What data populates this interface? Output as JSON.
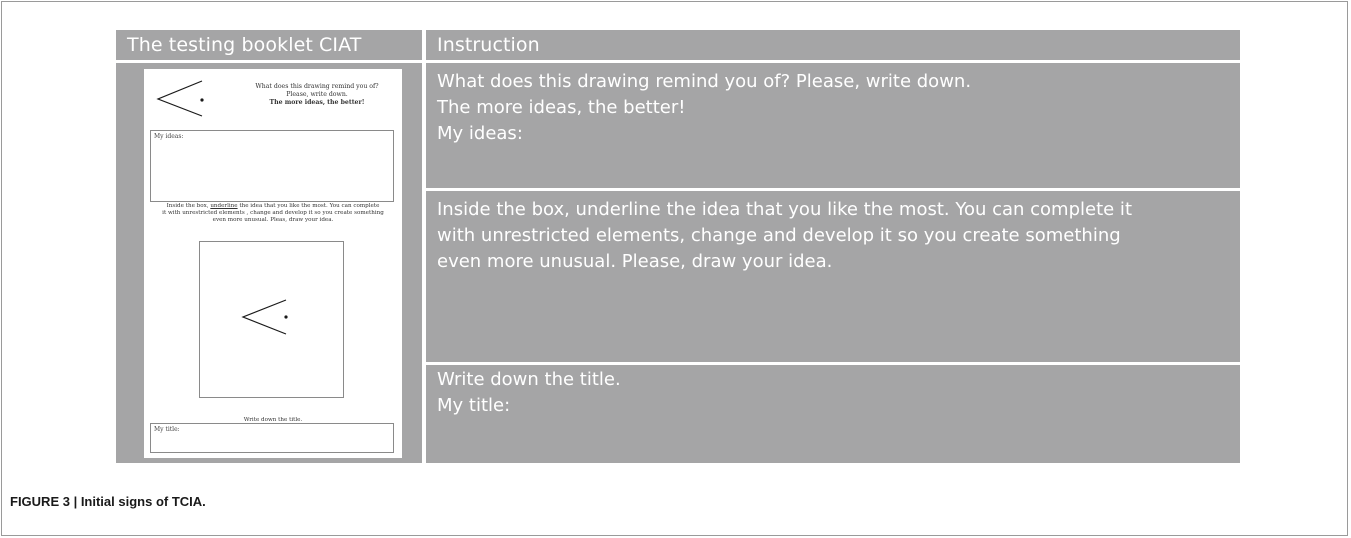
{
  "table": {
    "headers": {
      "left": "The testing booklet CIAT",
      "right": "Instruction"
    },
    "instructions": [
      [
        "What does this drawing remind you of? Please, write down.",
        "The more ideas, the better!",
        "My ideas:"
      ],
      [
        "Inside the box, underline the idea that you like the most. You can complete it",
        "with unrestricted elements, change and develop it so you create something",
        "even more unusual. Please, draw your idea."
      ],
      [
        "Write down the title.",
        "My title:"
      ]
    ]
  },
  "booklet": {
    "question_line1": "What does this drawing remind you of?",
    "question_line2": "Please, write down.",
    "question_bold": "The more ideas, the better!",
    "ideas_label": "My ideas:",
    "mid_pre": "Inside the box, ",
    "mid_underlined": "underline",
    "mid_post": " the idea that you like the most. You can complete",
    "mid_line2": "it with unrestricted elements , change and develop it so you create something",
    "mid_line3": "even more unusual.  Pleas, draw your idea.",
    "write_title": "Write down the title.",
    "title_label": "My title:"
  },
  "caption": "FIGURE 3 | Initial signs of TCIA.",
  "colors": {
    "cell_gray": "#a5a5a6",
    "text_white": "#ffffff"
  }
}
